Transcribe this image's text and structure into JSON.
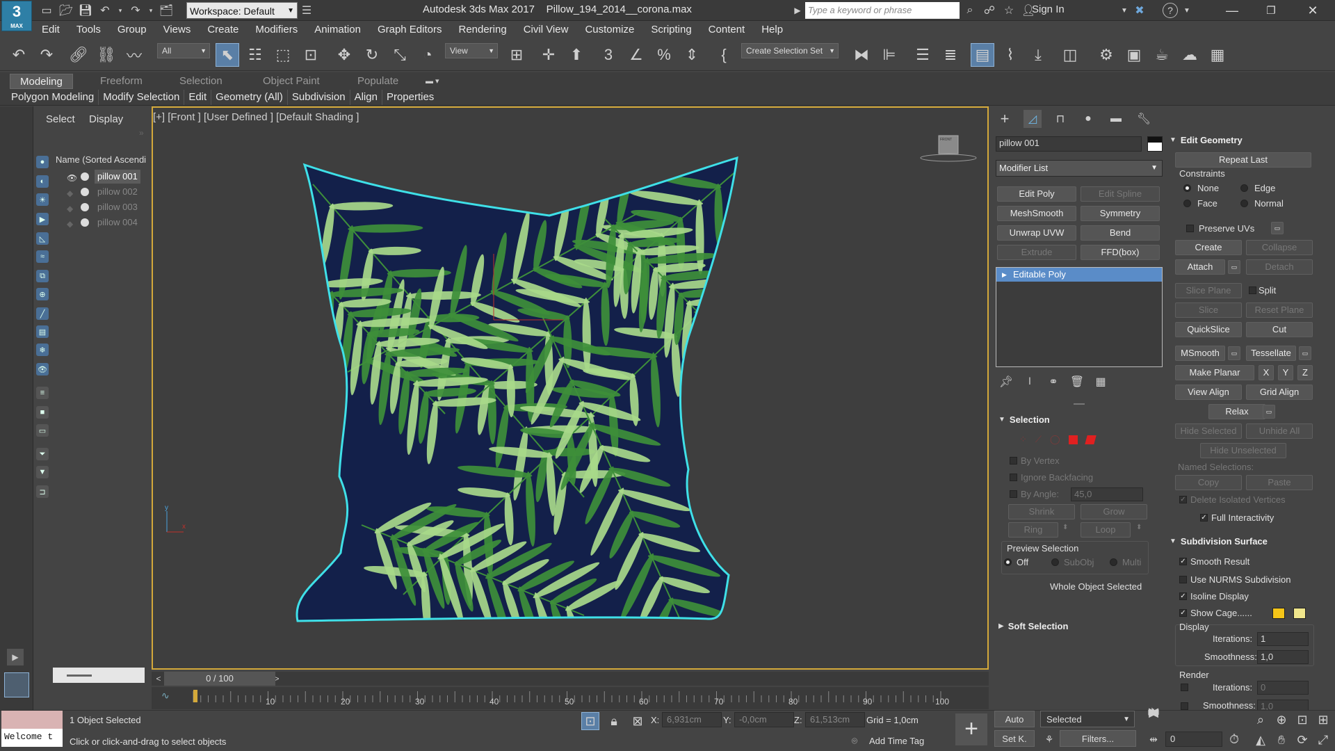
{
  "app": {
    "logo_main": "3",
    "logo_sub": "MAX",
    "workspace_label": "Workspace: Default",
    "title_app": "Autodesk 3ds Max 2017",
    "title_file": "Pillow_194_2014__corona.max",
    "search_placeholder": "Type a keyword or phrase",
    "signin": "Sign In"
  },
  "menu": [
    "Edit",
    "Tools",
    "Group",
    "Views",
    "Create",
    "Modifiers",
    "Animation",
    "Graph Editors",
    "Rendering",
    "Civil View",
    "Customize",
    "Scripting",
    "Content",
    "Help"
  ],
  "toolbar": {
    "filter": "All",
    "coord": "View",
    "selection_set": "Create Selection Set"
  },
  "ribbon": {
    "tabs": [
      "Modeling",
      "Freeform",
      "Selection",
      "Object Paint",
      "Populate"
    ],
    "active": "Modeling",
    "subtabs": [
      "Polygon Modeling",
      "Modify Selection",
      "Edit",
      "Geometry (All)",
      "Subdivision",
      "Align",
      "Properties"
    ]
  },
  "explorer": {
    "tab_select": "Select",
    "tab_display": "Display",
    "column": "Name (Sorted Ascendi",
    "items": [
      {
        "name": "pillow 001",
        "selected": true
      },
      {
        "name": "pillow 002",
        "selected": false
      },
      {
        "name": "pillow 003",
        "selected": false
      },
      {
        "name": "pillow 004",
        "selected": false
      }
    ]
  },
  "viewport": {
    "label": "[+] [Front ] [User Defined ] [Default Shading ]",
    "viewcube": "FRONT",
    "axis_y": "y",
    "axis_x": "x",
    "pillow_colors": {
      "fabric": "#13204a",
      "leaf_light": "#a8d98a",
      "leaf_dark": "#3e8f3a",
      "outline": "#3fe0e8"
    }
  },
  "timeline": {
    "slider": "0 / 100",
    "ticks": [
      "10",
      "20",
      "30",
      "40",
      "50",
      "60",
      "70",
      "80",
      "90",
      "100"
    ]
  },
  "command_panel": {
    "object_name": "pillow 001",
    "modifier_list": "Modifier List",
    "modifier_buttons": [
      {
        "label": "Edit Poly",
        "enabled": true
      },
      {
        "label": "Edit Spline",
        "enabled": false
      },
      {
        "label": "MeshSmooth",
        "enabled": true
      },
      {
        "label": "Symmetry",
        "enabled": true
      },
      {
        "label": "Unwrap UVW",
        "enabled": true
      },
      {
        "label": "Bend",
        "enabled": true
      },
      {
        "label": "Extrude",
        "enabled": false
      },
      {
        "label": "FFD(box)",
        "enabled": true
      }
    ],
    "stack_item": "Editable Poly",
    "selection": {
      "title": "Selection",
      "by_vertex": "By Vertex",
      "ignore_backfacing": "Ignore Backfacing",
      "by_angle": "By Angle:",
      "angle_value": "45,0",
      "shrink": "Shrink",
      "grow": "Grow",
      "ring": "Ring",
      "loop": "Loop",
      "preview_title": "Preview Selection",
      "off": "Off",
      "subobj": "SubObj",
      "multi": "Multi",
      "status": "Whole Object Selected"
    },
    "soft_selection": "Soft Selection"
  },
  "edit_geometry": {
    "title": "Edit Geometry",
    "repeat_last": "Repeat Last",
    "constraints": "Constraints",
    "none": "None",
    "edge": "Edge",
    "face": "Face",
    "normal": "Normal",
    "preserve_uvs": "Preserve UVs",
    "create": "Create",
    "collapse": "Collapse",
    "attach": "Attach",
    "detach": "Detach",
    "slice_plane": "Slice Plane",
    "split": "Split",
    "slice": "Slice",
    "reset_plane": "Reset Plane",
    "quickslice": "QuickSlice",
    "cut": "Cut",
    "msmooth": "MSmooth",
    "tessellate": "Tessellate",
    "make_planar": "Make Planar",
    "x": "X",
    "y": "Y",
    "z": "Z",
    "view_align": "View Align",
    "grid_align": "Grid Align",
    "relax": "Relax",
    "hide_selected": "Hide Selected",
    "unhide_all": "Unhide All",
    "hide_unselected": "Hide Unselected",
    "named_selections": "Named Selections:",
    "copy": "Copy",
    "paste": "Paste",
    "delete_isolated": "Delete Isolated Vertices",
    "full_interactivity": "Full Interactivity"
  },
  "subdivision": {
    "title": "Subdivision Surface",
    "smooth_result": "Smooth Result",
    "use_nurms": "Use NURMS Subdivision",
    "isoline": "Isoline Display",
    "show_cage": "Show Cage......",
    "cage_color_1": "#f5c518",
    "cage_color_2": "#f0e68c",
    "display": "Display",
    "iterations_label": "Iterations:",
    "iterations": "1",
    "smoothness_label": "Smoothness:",
    "smoothness": "1,0",
    "render": "Render",
    "render_iterations_label": "Iterations:",
    "render_iterations": "0",
    "render_smoothness_label": "Smoothness:",
    "render_smoothness": "1,0"
  },
  "status": {
    "welcome": "Welcome t",
    "objects": "1 Object Selected",
    "prompt": "Click or click-and-drag to select objects",
    "x_label": "X:",
    "x": "6,931cm",
    "y_label": "Y:",
    "y": "-0,0cm",
    "z_label": "Z:",
    "z": "61,513cm",
    "grid": "Grid = 1,0cm",
    "add_time_tag": "Add Time Tag",
    "auto": "Auto",
    "set_key": "Set K.",
    "key_mode": "Selected",
    "filters": "Filters...",
    "frame": "0"
  }
}
